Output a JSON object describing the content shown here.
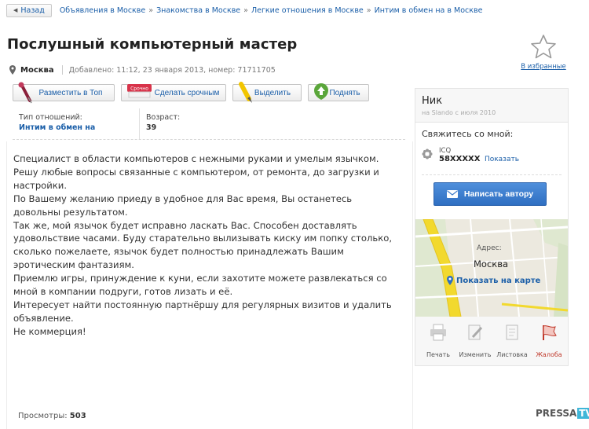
{
  "breadcrumb": {
    "back_label": "Назад",
    "items": [
      "Объявления в Москве",
      "Знакомства в Москве",
      "Легкие отношения в Москве",
      "Интим в обмен на в Москве"
    ],
    "separator": "»"
  },
  "listing": {
    "title": "Послушный компьютерный мастер",
    "city": "Москва",
    "added": "Добавлено: 11:12, 23 января 2013, номер: 71711705",
    "favorite_label": "В избранные"
  },
  "toolbar": {
    "top_label": "Разместить в Топ",
    "urgent_label": "Сделать срочным",
    "urgent_badge": "Срочно",
    "highlight_label": "Выделить",
    "raise_label": "Поднять"
  },
  "params": [
    {
      "label": "Тип отношений:",
      "value": "Интим в обмен на"
    },
    {
      "label": "Возраст:",
      "value": "39"
    }
  ],
  "description": [
    "Специалист в области компьютеров с нежными руками и умелым язычком.",
    "Решу любые вопросы связанные с компьютером, от ремонта, до загрузки и",
    "настройки.",
    "По Вашему желанию приеду в удобное для Вас время, Вы останетесь",
    "довольны результатом.",
    "Так же, мой язычок будет исправно ласкать Вас. Способен доставлять",
    "удовольствие часами. Буду старательно вылизывать киску им попку столько,",
    "сколько пожелаете, язычок будет полностью принадлежать Вашим",
    "эротическим фантазиям.",
    "Приемлю игры, принуждение к куни, если захотите можете развлекаться со",
    "мной в компании подруги, готов лизать и её.",
    "Интересует найти постоянную партнёршу для регулярных визитов и удалить",
    "объявление.",
    "Не коммерция!"
  ],
  "views": {
    "label": "Просмотры:",
    "count": "503"
  },
  "seller": {
    "name": "Ник",
    "since": "на Slando с июля 2010",
    "contact_title": "Свяжитесь со мной:",
    "icq_label": "ICQ",
    "icq_number": "58XXXXX",
    "show_label": "Показать",
    "write_button": "Написать автору"
  },
  "map": {
    "address_label": "Адрес:",
    "address": "Москва",
    "show_map_label": "Показать на карте"
  },
  "actions": {
    "print": "Печать",
    "edit": "Изменить",
    "flyer": "Листовка",
    "report": "Жалоба"
  },
  "watermark": {
    "part1": "PRESSA",
    "part2": "TV"
  },
  "colors": {
    "link": "#1a5ea8",
    "button": "#3a7bd0",
    "report": "#c0392b"
  }
}
